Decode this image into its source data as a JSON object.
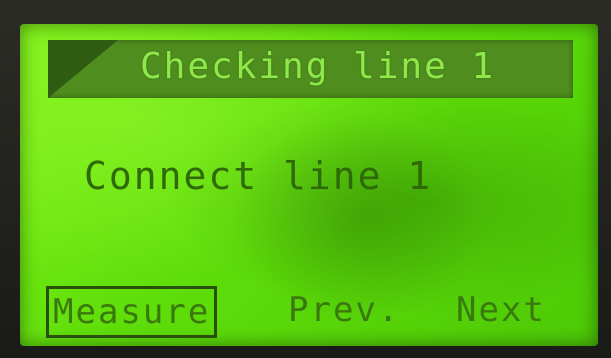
{
  "screen": {
    "title": "Checking line 1",
    "message": "Connect line 1"
  },
  "softkeys": {
    "measure": "Measure",
    "prev": "Prev.",
    "next": "Next"
  },
  "colors": {
    "lcd_background": "#5fde0a",
    "title_bar": "#4e8d1e",
    "title_text": "#8fe84a",
    "pixel_text": "#2f6a08"
  }
}
